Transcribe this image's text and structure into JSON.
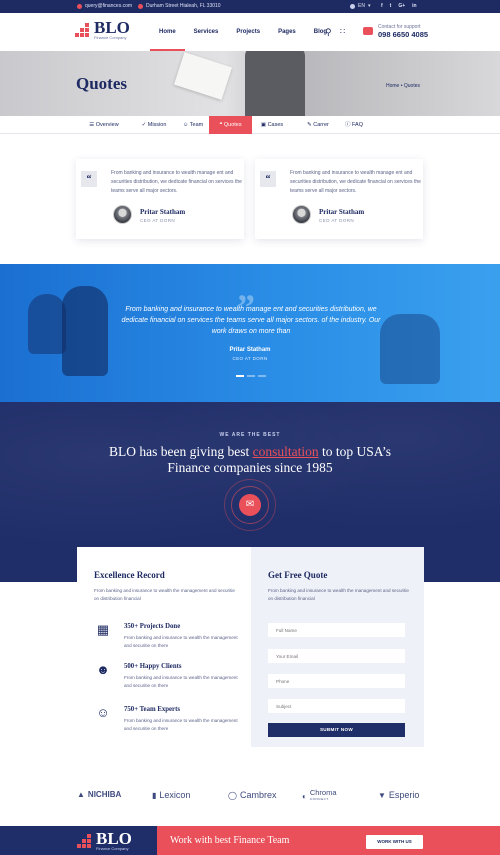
{
  "topbar": {
    "email": "query@finances.com",
    "address": "Durham Street Hialeah, FL 33010",
    "language": "EN",
    "social": [
      "f",
      "t",
      "G+",
      "in"
    ]
  },
  "header": {
    "logo_text": "BLO",
    "logo_sub": "Finance Company",
    "nav": [
      "Home",
      "Services",
      "Projects",
      "Pages",
      "Blog"
    ],
    "support_label": "Contact for support",
    "support_phone": "098 6650 4085"
  },
  "banner": {
    "title": "Quotes",
    "breadcrumb": "Home  •  Quotes"
  },
  "tabs": [
    "Overview",
    "Mission",
    "Team",
    "Quotes",
    "Cases",
    "Carrer",
    "FAQ"
  ],
  "quotes": [
    {
      "text": "From banking and  insurance to wealth manage ent and securities distribution, we dedicate financial on services the teams serve all major sectors.",
      "name": "Pritar Statham",
      "role": "CEO AT DORN"
    },
    {
      "text": "From banking and  insurance to wealth manage ent and securities distribution, we dedicate financial on services the teams serve all major sectors.",
      "name": "Pritar Statham",
      "role": "CEO AT DORN"
    }
  ],
  "testimonial": {
    "text": "From banking and  insurance to wealth manage ent and securities distribution, we dedicate financial on services the teams serve all major sectors. of the industry. Our work draws on more than",
    "name": "Pritar Statham",
    "role": "CEO AT DORN"
  },
  "about": {
    "kicker": "WE ARE THE BEST",
    "title_pre": "BLO has been giving best ",
    "title_highlight": "consultation",
    "title_post": " to top USA’s",
    "title_line2": "Finance companies since 1985"
  },
  "excellence": {
    "title": "Excellence Record",
    "desc": "From banking and  insurance to wealth the management and securitie on distribution financial",
    "stats": [
      {
        "title": "350+ Projects Done",
        "desc": "From banking and  insurance to wealth the management and securitie on there"
      },
      {
        "title": "500+ Happy Clients",
        "desc": "From banking and  insurance to wealth the management and securitie on there"
      },
      {
        "title": "750+ Team Experts",
        "desc": "From banking and  insurance to wealth the management and securitie on there"
      }
    ]
  },
  "quote_form": {
    "title": "Get Free Quote",
    "desc": "From banking and  insurance to wealth the management and securitie on distribution financial",
    "fields": [
      "Full Name",
      "Your Email",
      "Phone",
      "Subject"
    ],
    "submit": "SUBMIT NOW"
  },
  "brands": [
    "NICHIBA",
    "Lexicon",
    "Cambrex",
    "Chroma",
    "Esperio"
  ],
  "brand_sub": "CONNECT",
  "footer_cta": {
    "logo_text": "BLO",
    "logo_sub": "Finance Company",
    "text": "Work with best Finance Team",
    "button": "WORK WITH US"
  },
  "colors": {
    "navy": "#1f2d69",
    "accent": "#e9505a",
    "blue": "#2a8de6"
  }
}
